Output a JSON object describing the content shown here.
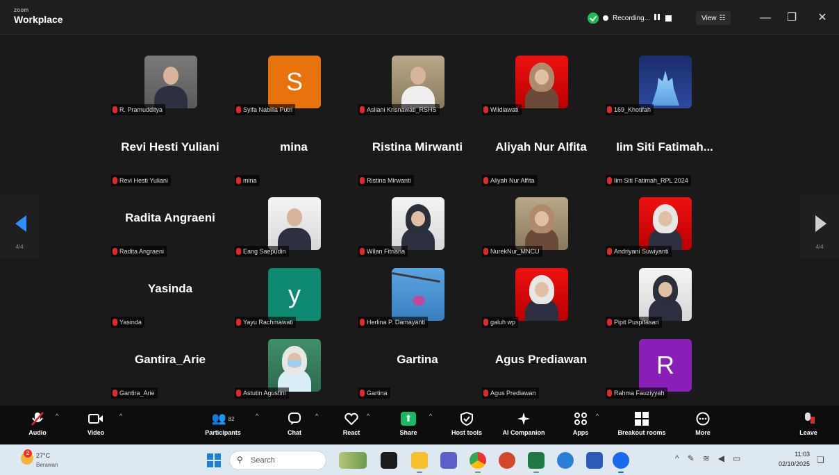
{
  "window": {
    "brand_small": "zoom",
    "brand_title": "Workplace",
    "recording_label": "Recording...",
    "view_label": "View",
    "minimize_glyph": "—",
    "restore_glyph": "❐",
    "close_glyph": "✕"
  },
  "gallery": {
    "page_indicator_left": "4/4",
    "page_indicator_right": "4/4",
    "tiles": [
      {
        "kind": "photo",
        "style": "p-grey",
        "figure": "man",
        "label": "R. Pramudditya"
      },
      {
        "kind": "initial",
        "initial": "S",
        "color": "#e8730c",
        "label": "Syifa Nabilla Putri"
      },
      {
        "kind": "photo",
        "style": "p-warm",
        "figure": "baby",
        "label": "Asliani Krisnawati_RSHS"
      },
      {
        "kind": "photo",
        "style": "p-red",
        "figure": "hijab-brown",
        "label": "Wildiawati"
      },
      {
        "kind": "photo",
        "style": "p-blue",
        "figure": "castle",
        "label": "169_Khotifah"
      },
      {
        "kind": "name",
        "bigname": "Revi Hesti Yuliani",
        "label": "Revi Hesti Yuliani"
      },
      {
        "kind": "name",
        "bigname": "mina",
        "label": "mina"
      },
      {
        "kind": "name",
        "bigname": "Ristina Mirwanti",
        "label": "Ristina Mirwanti"
      },
      {
        "kind": "name",
        "bigname": "Aliyah Nur Alfita",
        "label": "Aliyah Nur Alfita"
      },
      {
        "kind": "name",
        "bigname": "Iim Siti Fatimah...",
        "label": "Iim Siti Fatimah_RPL 2024"
      },
      {
        "kind": "name",
        "bigname": "Radita Angraeni",
        "label": "Radita Angraeni"
      },
      {
        "kind": "photo",
        "style": "p-white",
        "figure": "man",
        "label": "Eang Saepudin"
      },
      {
        "kind": "photo",
        "style": "p-white",
        "figure": "hijab-dark",
        "label": "Wilan Fitriana"
      },
      {
        "kind": "photo",
        "style": "p-warm",
        "figure": "hijab-brown",
        "label": "NurekNur_MNCU"
      },
      {
        "kind": "photo",
        "style": "p-red",
        "figure": "hijab-white",
        "label": "Andriyani Suwiyanti"
      },
      {
        "kind": "name",
        "bigname": "Yasinda",
        "label": "Yasinda"
      },
      {
        "kind": "initial",
        "initial": "y",
        "color": "#0f8a72",
        "label": "Yayu Rachmawati"
      },
      {
        "kind": "photo",
        "style": "p-sky",
        "figure": "flower",
        "label": "Herlina P. Damayanti"
      },
      {
        "kind": "photo",
        "style": "p-red",
        "figure": "hijab-white",
        "label": "galuh wp"
      },
      {
        "kind": "photo",
        "style": "p-white",
        "figure": "hijab-dark",
        "label": "Pipit Puspitasari"
      },
      {
        "kind": "name",
        "bigname": "Gantira_Arie",
        "label": "Gantira_Arie"
      },
      {
        "kind": "photo",
        "style": "p-teal",
        "figure": "mask",
        "label": "Astutin Agustini"
      },
      {
        "kind": "name",
        "bigname": "Gartina",
        "label": "Gartina"
      },
      {
        "kind": "name",
        "bigname": "Agus Prediawan",
        "label": "Agus Prediawan"
      },
      {
        "kind": "initial",
        "initial": "R",
        "color": "#8a1fb8",
        "label": "Rahma Fauziyyah"
      }
    ]
  },
  "toolbar": {
    "audio": "Audio",
    "video": "Video",
    "participants": "Participants",
    "participants_count": "82",
    "chat": "Chat",
    "react": "React",
    "share": "Share",
    "host_tools": "Host tools",
    "ai_companion": "AI Companion",
    "apps": "Apps",
    "breakout_rooms": "Breakout rooms",
    "more": "More",
    "leave": "Leave"
  },
  "taskbar": {
    "weather_badge": "2",
    "temperature": "27°C",
    "condition": "Berawan",
    "search_placeholder": "Search",
    "time": "11:03",
    "date": "02/10/2025"
  }
}
